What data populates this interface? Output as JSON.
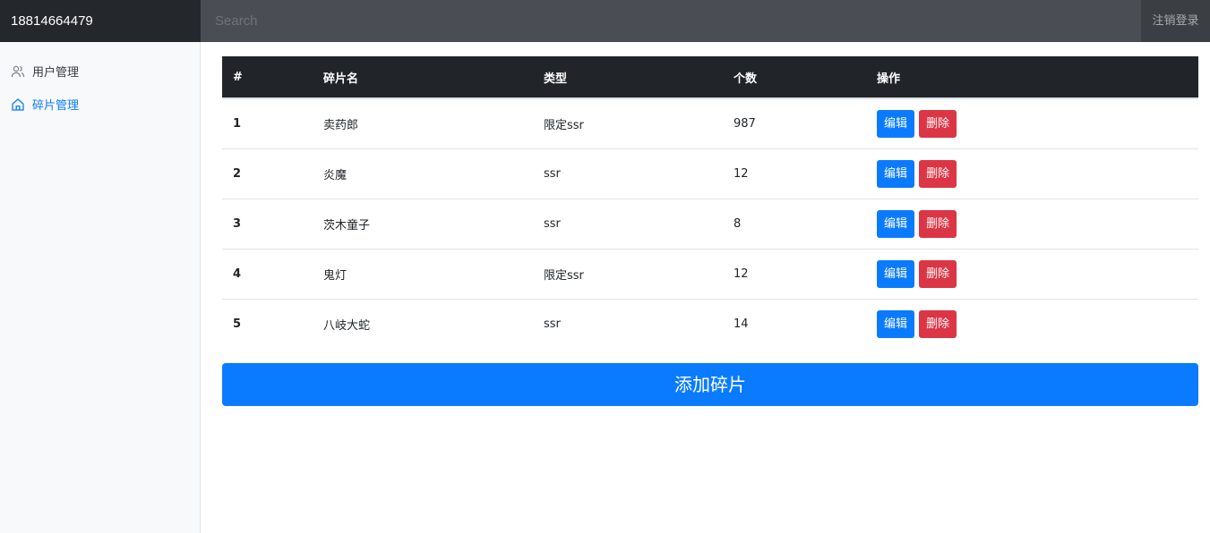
{
  "header": {
    "username": "18814664479",
    "search_placeholder": "Search",
    "logout_label": "注销登录"
  },
  "sidebar": {
    "items": [
      {
        "label": "用户管理",
        "icon": "users-icon",
        "active": false
      },
      {
        "label": "碎片管理",
        "icon": "home-icon",
        "active": true
      }
    ]
  },
  "table": {
    "headers": [
      "#",
      "碎片名",
      "类型",
      "个数",
      "操作"
    ],
    "rows": [
      {
        "id": "1",
        "name": "卖药郎",
        "type": "限定ssr",
        "count": "987"
      },
      {
        "id": "2",
        "name": "炎魔",
        "type": "ssr",
        "count": "12"
      },
      {
        "id": "3",
        "name": "茨木童子",
        "type": "ssr",
        "count": "8"
      },
      {
        "id": "4",
        "name": "鬼灯",
        "type": "限定ssr",
        "count": "12"
      },
      {
        "id": "5",
        "name": "八岐大蛇",
        "type": "ssr",
        "count": "14"
      }
    ],
    "edit_label": "编辑",
    "delete_label": "删除"
  },
  "add_button_label": "添加碎片",
  "colors": {
    "primary": "#0a7bff",
    "danger": "#dc3545",
    "topbar": "#343a40",
    "table_header": "#212529"
  }
}
